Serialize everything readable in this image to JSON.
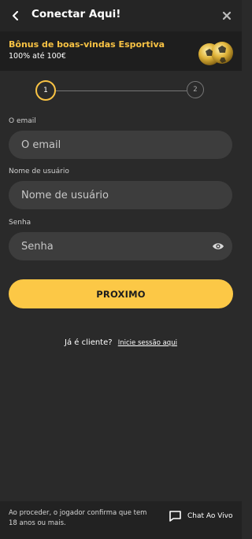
{
  "header": {
    "title": "Conectar Aqui!"
  },
  "bonus": {
    "title": "Bônus de boas-vindas Esportiva",
    "subtitle": "100% até 100€"
  },
  "stepper": {
    "step1": "1",
    "step2": "2"
  },
  "form": {
    "email": {
      "label": "O email",
      "placeholder": "O email"
    },
    "username": {
      "label": "Nome de usuário",
      "placeholder": "Nome de usuário"
    },
    "password": {
      "label": "Senha",
      "placeholder": "Senha"
    },
    "next_label": "PROXIMO"
  },
  "login": {
    "question": "Já é cliente?",
    "link": "Inicie sessão aqui"
  },
  "footer": {
    "disclaimer": "Ao proceder, o jogador confirma que tem 18 anos ou mais.",
    "chat_label": "Chat Ao Vivo"
  },
  "colors": {
    "accent": "#fcc846",
    "background": "#2a2a2a",
    "field": "#3d3d3d"
  }
}
